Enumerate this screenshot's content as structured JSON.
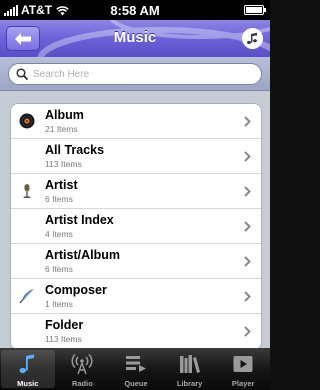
{
  "status": {
    "carrier": "AT&T",
    "time": "8:58 AM"
  },
  "nav": {
    "title": "Music",
    "back_icon": "back-arrow-icon",
    "right_icon": "music-note-icon"
  },
  "search": {
    "placeholder": "Search Here",
    "value": ""
  },
  "list": [
    {
      "title": "Album",
      "subtitle": "21 Items",
      "icon": "record-icon"
    },
    {
      "title": "All Tracks",
      "subtitle": "113 Items",
      "icon": ""
    },
    {
      "title": "Artist",
      "subtitle": "6 Items",
      "icon": "microphone-icon"
    },
    {
      "title": "Artist Index",
      "subtitle": "4 Items",
      "icon": ""
    },
    {
      "title": "Artist/Album",
      "subtitle": "6 Items",
      "icon": ""
    },
    {
      "title": "Composer",
      "subtitle": "1 Items",
      "icon": "quill-pen-icon"
    },
    {
      "title": "Folder",
      "subtitle": "113 Items",
      "icon": ""
    }
  ],
  "tabs": [
    {
      "label": "Music",
      "icon": "music-note-icon",
      "active": true
    },
    {
      "label": "Radio",
      "icon": "radio-tower-icon",
      "active": false
    },
    {
      "label": "Queue",
      "icon": "queue-icon",
      "active": false
    },
    {
      "label": "Library",
      "icon": "library-icon",
      "active": false
    },
    {
      "label": "Player",
      "icon": "player-icon",
      "active": false
    }
  ],
  "colors": {
    "nav_purple": "#6a5fd6",
    "list_bg": "#c5ccd4",
    "tab_bar": "#0a0a0a"
  }
}
